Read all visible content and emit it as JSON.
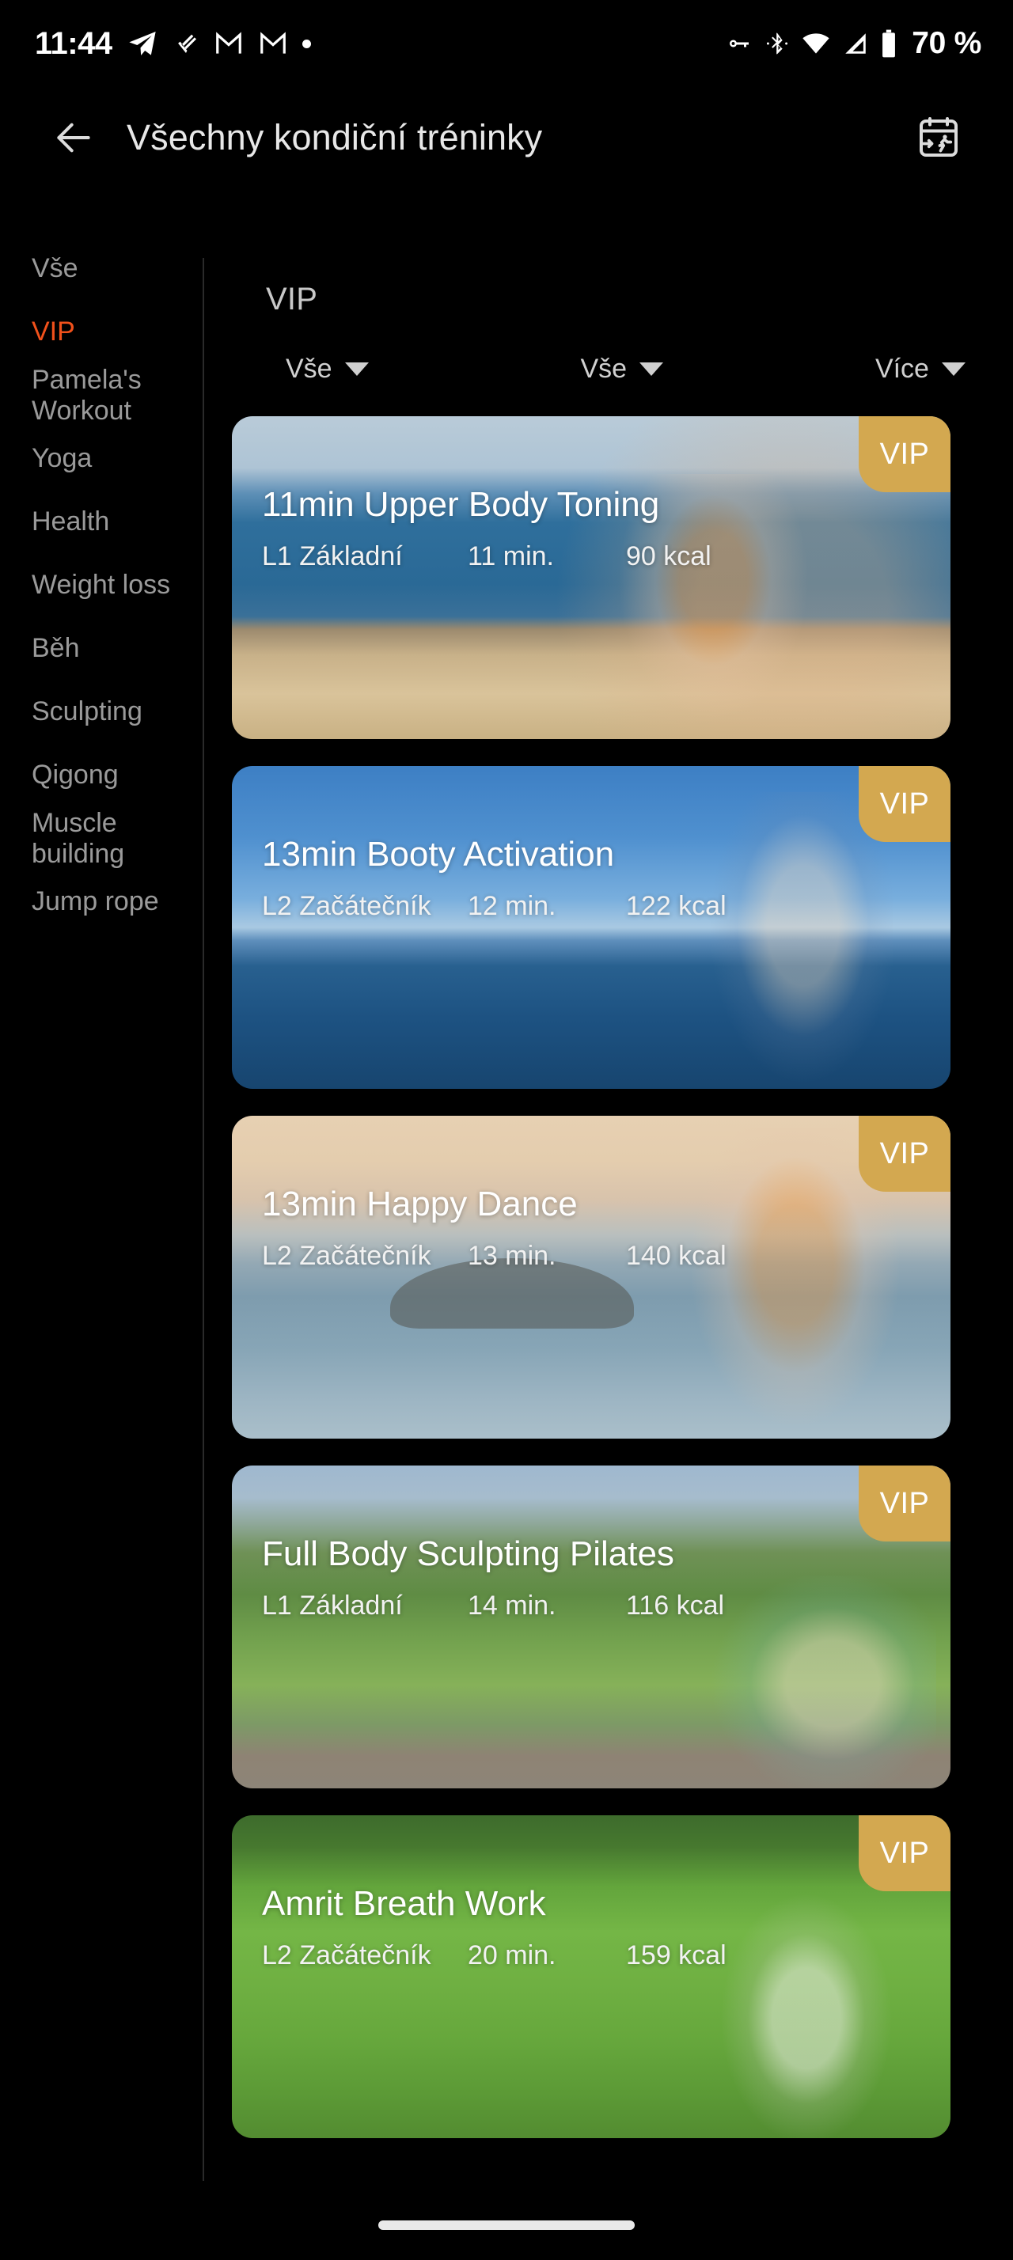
{
  "status_bar": {
    "time": "11:44",
    "battery_percent": "70 %",
    "left_icons": [
      "telegram-icon",
      "heart-slash-icon",
      "gmail-icon",
      "gmail-icon",
      "dot-icon"
    ],
    "right_icons": [
      "vpn-key-icon",
      "bluetooth-icon",
      "wifi-icon",
      "cellular-signal-icon",
      "battery-icon"
    ]
  },
  "app_bar": {
    "back_label": "back-arrow",
    "title": "Všechny kondiční tréninky",
    "action_icon": "calendar-run-icon"
  },
  "sidebar": {
    "items": [
      {
        "label": "Vše",
        "active": false
      },
      {
        "label": "VIP",
        "active": true
      },
      {
        "label": "Pamela's Workout",
        "active": false
      },
      {
        "label": "Yoga",
        "active": false
      },
      {
        "label": "Health",
        "active": false
      },
      {
        "label": "Weight loss",
        "active": false
      },
      {
        "label": "Běh",
        "active": false
      },
      {
        "label": "Sculpting",
        "active": false
      },
      {
        "label": "Qigong",
        "active": false
      },
      {
        "label": "Muscle building",
        "active": false
      },
      {
        "label": "Jump rope",
        "active": false
      }
    ],
    "active_color": "#f1511b",
    "inactive_color": "#9a9a9a"
  },
  "main": {
    "section_title": "VIP",
    "filters": [
      {
        "label": "Vše"
      },
      {
        "label": "Vše"
      },
      {
        "label": "Více"
      }
    ],
    "badge_label": "VIP",
    "badge_color": "#d3a850",
    "cards": [
      {
        "title": "11min Upper Body Toning",
        "level": "L1 Základní",
        "duration": "11 min.",
        "calories": "90 kcal",
        "badge": "VIP",
        "image": "woman-flexing-on-cliff-by-sea"
      },
      {
        "title": "13min Booty Activation",
        "level": "L2 Začátečník",
        "duration": "12 min.",
        "calories": "122 kcal",
        "badge": "VIP",
        "image": "woman-standing-by-blue-sea"
      },
      {
        "title": "13min Happy Dance",
        "level": "L2 Začátečník",
        "duration": "13 min.",
        "calories": "140 kcal",
        "badge": "VIP",
        "image": "woman-in-orange-top-at-sunset-coast"
      },
      {
        "title": "Full Body Sculpting Pilates",
        "level": "L1 Základní",
        "duration": "14 min.",
        "calories": "116 kcal",
        "badge": "VIP",
        "image": "woman-doing-pilates-on-alpine-meadow"
      },
      {
        "title": "Amrit Breath Work",
        "level": "L2 Začátečník",
        "duration": "20 min.",
        "calories": "159 kcal",
        "badge": "VIP",
        "image": "man-breathing-in-green-grass-field"
      }
    ]
  },
  "system_nav": {
    "home_indicator": "home-indicator"
  }
}
